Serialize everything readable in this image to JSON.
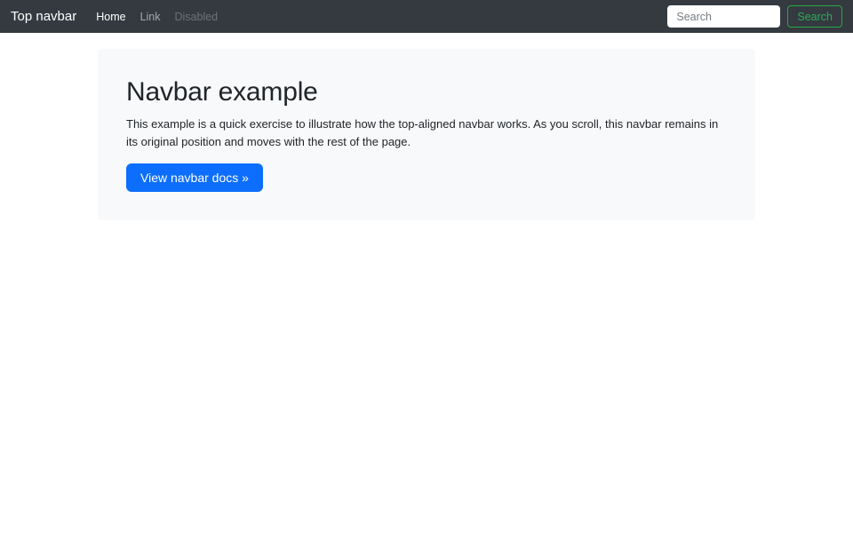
{
  "navbar": {
    "brand": "Top navbar",
    "links": [
      {
        "label": "Home",
        "state": "active"
      },
      {
        "label": "Link",
        "state": "normal"
      },
      {
        "label": "Disabled",
        "state": "disabled"
      }
    ],
    "search": {
      "placeholder": "Search",
      "value": "",
      "button_label": "Search"
    }
  },
  "jumbotron": {
    "title": "Navbar example",
    "description": "This example is a quick exercise to illustrate how the top-aligned navbar works. As you scroll, this navbar remains in its original position and moves with the rest of the page.",
    "cta_label": "View navbar docs »"
  },
  "colors": {
    "navbar_bg": "#343a40",
    "jumbotron_bg": "#f8f9fa",
    "primary": "#0d6efd",
    "success_outline": "#28a745",
    "text": "#212529"
  }
}
